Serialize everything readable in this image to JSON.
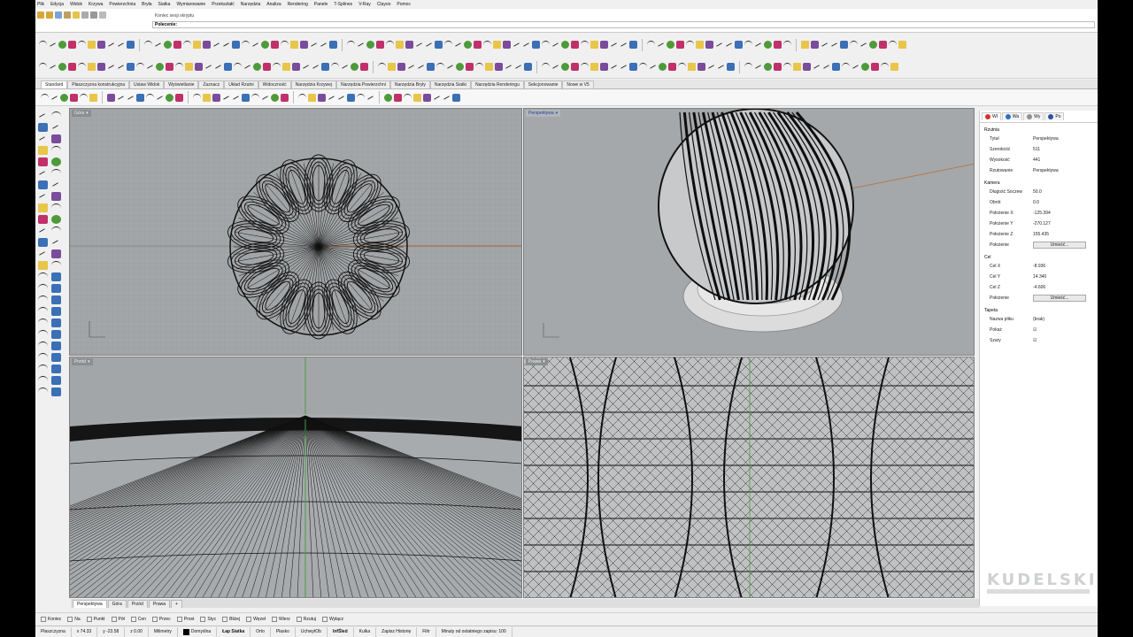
{
  "menu": [
    "Plik",
    "Edycja",
    "Widok",
    "Krzywa",
    "Powierzchnia",
    "Bryła",
    "Siatka",
    "Wymiarowanie",
    "Przekształć",
    "Narzędzia",
    "Analiza",
    "Rendering",
    "Panele",
    "T-Splines",
    "V-Ray",
    "Clayoo",
    "Pomoc"
  ],
  "command": {
    "history": "Koniec sesji skryptu",
    "prompt": "Polecenie:"
  },
  "tabs": [
    "Standard",
    "Płaszczyzna konstrukcyjna",
    "Ustaw Widok",
    "Wyświetlanie",
    "Zaznacz",
    "Układ Rzutni",
    "Widoczność",
    "Narzędzia Krzywej",
    "Narzędzia Powierzchni",
    "Narzędzia Bryły",
    "Narzędzia Siatki",
    "Narzędzia Renderingu",
    "Sekcjonowanie",
    "Nowe w V5"
  ],
  "viewports": {
    "top": "Góra",
    "perspective": "Perspektywa",
    "front": "Przód",
    "right": "Prawa"
  },
  "panel": {
    "tabs": [
      "Wł",
      "Wa",
      "Wy",
      "Po"
    ],
    "sections": {
      "viewport": "Rzutnia",
      "camera": "Kamera",
      "target": "Cel",
      "wallpaper": "Tapeta"
    },
    "viewport_rows": [
      {
        "k": "Tytuł",
        "v": "Perspektywa"
      },
      {
        "k": "Szerokość",
        "v": "511"
      },
      {
        "k": "Wysokość",
        "v": "441"
      },
      {
        "k": "Rzutowanie",
        "v": "Perspektywa"
      }
    ],
    "camera_rows": [
      {
        "k": "Długość Soczew",
        "v": "50.0"
      },
      {
        "k": "Obrót",
        "v": "0.0"
      },
      {
        "k": "Położenie X",
        "v": "-125.394"
      },
      {
        "k": "Położenie Y",
        "v": "-270.127"
      },
      {
        "k": "Położenie Z",
        "v": "155.435"
      },
      {
        "k": "Położenie",
        "v": "Umieść..."
      }
    ],
    "target_rows": [
      {
        "k": "Cel X",
        "v": "-8.936"
      },
      {
        "k": "Cel Y",
        "v": "14.340"
      },
      {
        "k": "Cel Z",
        "v": "-4.606"
      },
      {
        "k": "Położenie",
        "v": "Umieść..."
      }
    ],
    "wallpaper_rows": [
      {
        "k": "Nazwa pliku",
        "v": "(brak)"
      },
      {
        "k": "Pokaż",
        "v": "☑"
      },
      {
        "k": "Szary",
        "v": "☑"
      }
    ],
    "logo": "KUDELSKI"
  },
  "viewport_tabs": [
    "Perspektywa",
    "Góra",
    "Przód",
    "Prawa",
    "+"
  ],
  "osnaps": [
    "Koniec",
    "Na",
    "Punkt",
    "Pół",
    "Cen",
    "Przec",
    "Prost",
    "Styc",
    "Bliżej",
    "Węzeł",
    "Wierz",
    "Rzutuj",
    "Wyłącz"
  ],
  "status": {
    "cplane": "Płaszczyzna",
    "x": "x 74.33",
    "y": "y -23.58",
    "z": "z 0.00",
    "units": "Milimetry",
    "layer": "Domyślna",
    "buttons": [
      "Łap Siatka",
      "Orto",
      "Płasko",
      "UchwytOb",
      "InfŚled",
      "Kulka",
      "Zapisz Historię",
      "Filtr"
    ],
    "message": "Minuty od ostatniego zapisu: 100"
  }
}
